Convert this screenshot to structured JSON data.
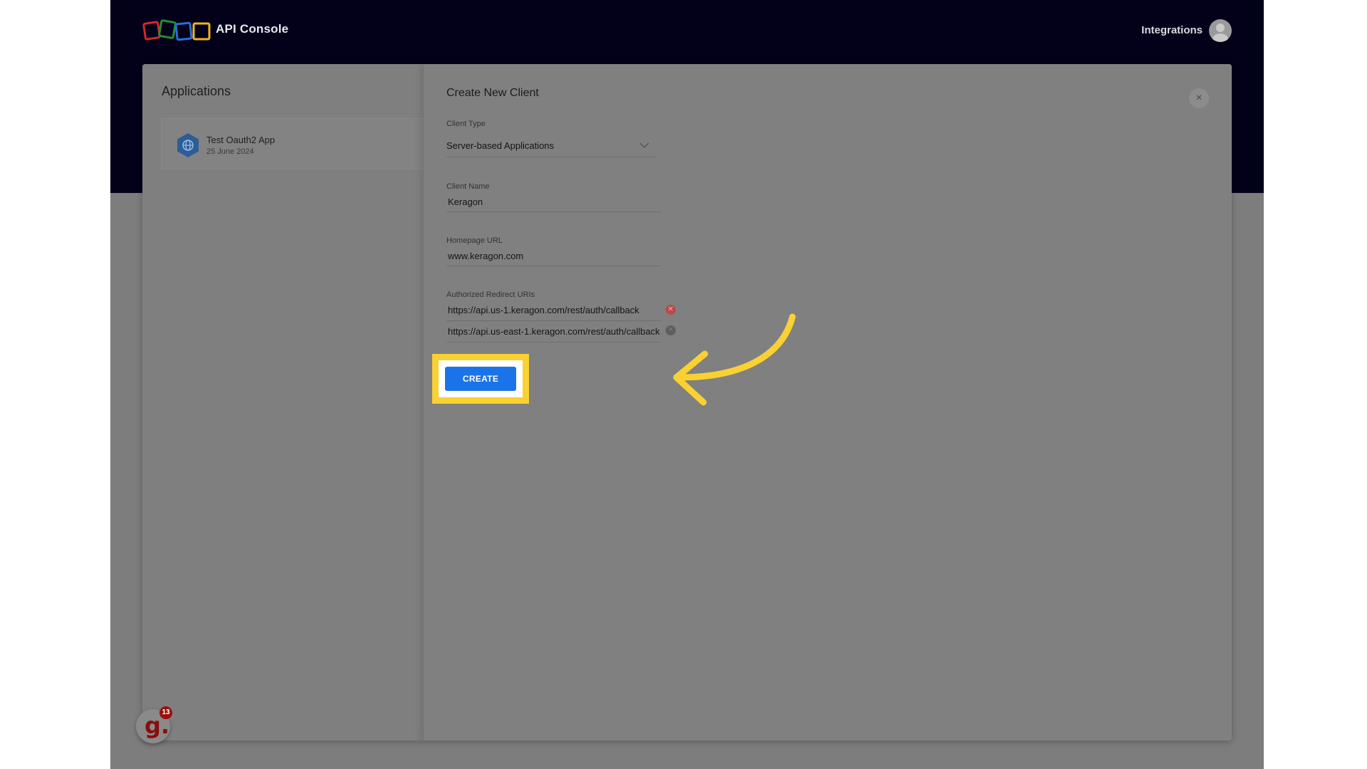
{
  "header": {
    "app_title": "API Console",
    "integrations_label": "Integrations"
  },
  "applications": {
    "title": "Applications",
    "items": [
      {
        "name": "Test Oauth2 App",
        "date": "25 June 2024"
      }
    ]
  },
  "form": {
    "title": "Create New Client",
    "client_type_label": "Client Type",
    "client_type_value": "Server-based Applications",
    "client_name_label": "Client Name",
    "client_name_value": "Keragon",
    "homepage_label": "Homepage URL",
    "homepage_value": "www.keragon.com",
    "redirect_label": "Authorized Redirect URIs",
    "redirect_uris": [
      "https://api.us-1.keragon.com/rest/auth/callback",
      "https://api.us-east-1.keragon.com/rest/auth/callback"
    ],
    "create_label": "CREATE",
    "close_symbol": "×"
  },
  "widget": {
    "letter": "g.",
    "count": "13"
  },
  "colors": {
    "header_bg": "#03011a",
    "primary_button": "#1a73e8",
    "highlight": "#f9d132",
    "remove_icon": "#b94a48"
  }
}
